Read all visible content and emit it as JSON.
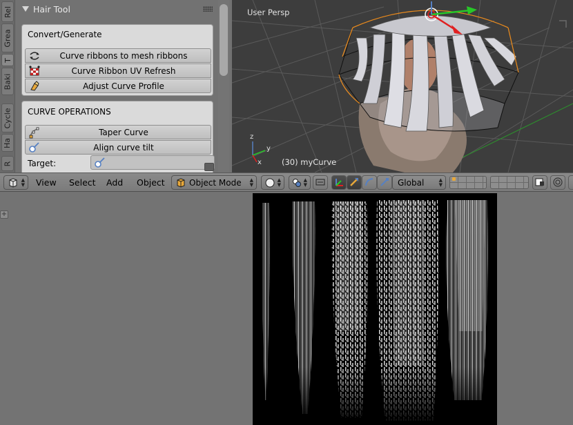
{
  "tool_shelf": {
    "tabs": [
      "Rel",
      "Grea",
      "T",
      "Baki",
      "Cycle",
      "Ha",
      "R"
    ],
    "panel_title": "Hair Tool",
    "convert_box": {
      "title": "Convert/Generate",
      "buttons": [
        "Curve ribbons to mesh ribbons",
        "Curve Ribbon UV Refresh",
        "Adjust Curve Profile"
      ]
    },
    "curve_ops_box": {
      "title": "CURVE OPERATIONS",
      "buttons": [
        "Taper Curve",
        "Align curve tilt"
      ],
      "target_label": "Target:"
    }
  },
  "viewport": {
    "view_label": "User Persp",
    "object_label": "(30) myCurve",
    "axes": {
      "x": "x",
      "y": "y",
      "z": "z"
    }
  },
  "header": {
    "menus": [
      "View",
      "Select",
      "Add",
      "Object"
    ],
    "mode": "Object Mode",
    "orientation": "Global"
  },
  "colors": {
    "accent_blue": "#5680c2",
    "manip_red": "#e02020",
    "manip_green": "#28c828"
  }
}
